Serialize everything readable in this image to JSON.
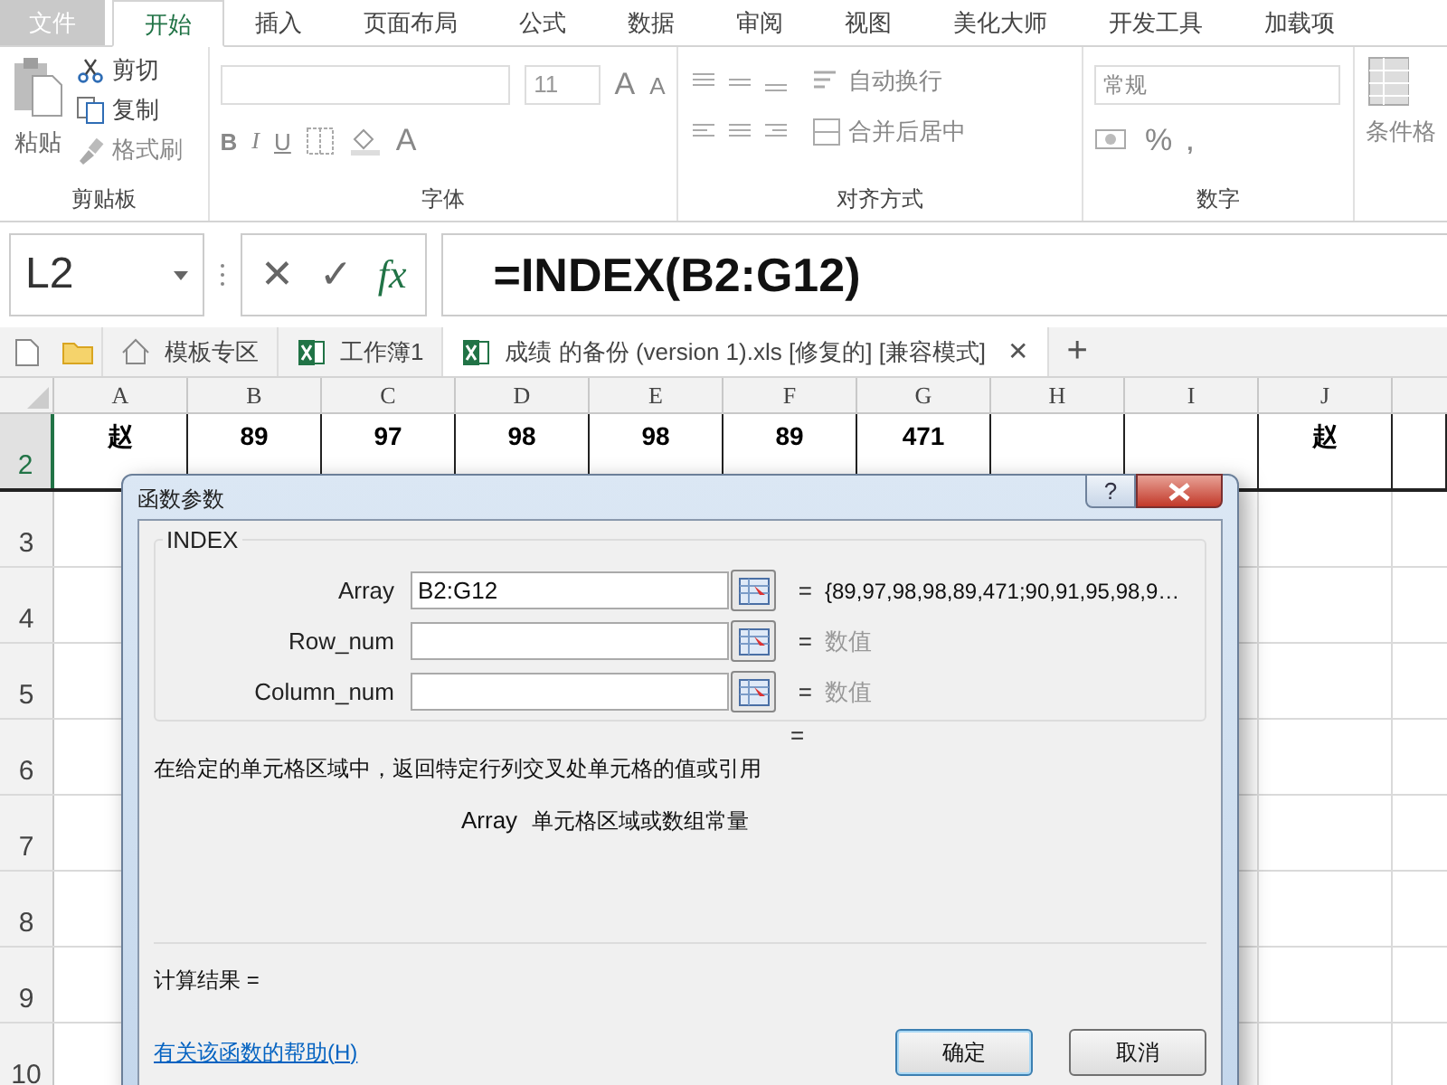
{
  "ribbon": {
    "tabs": [
      {
        "label": "文件",
        "kind": "file",
        "selected": false
      },
      {
        "label": "开始",
        "kind": "tab",
        "selected": true
      },
      {
        "label": "插入",
        "kind": "tab",
        "selected": false
      },
      {
        "label": "页面布局",
        "kind": "tab",
        "selected": false
      },
      {
        "label": "公式",
        "kind": "tab",
        "selected": false
      },
      {
        "label": "数据",
        "kind": "tab",
        "selected": false
      },
      {
        "label": "审阅",
        "kind": "tab",
        "selected": false
      },
      {
        "label": "视图",
        "kind": "tab",
        "selected": false
      },
      {
        "label": "美化大师",
        "kind": "tab",
        "selected": false
      },
      {
        "label": "开发工具",
        "kind": "tab",
        "selected": false
      },
      {
        "label": "加载项",
        "kind": "tab",
        "selected": false
      }
    ],
    "clipboard": {
      "paste": "粘贴",
      "cut": "剪切",
      "copy": "复制",
      "format_painter": "格式刷",
      "label": "剪贴板"
    },
    "font": {
      "size": "11",
      "grow": "A",
      "shrink": "A",
      "bold": "B",
      "italic": "I",
      "underline": "U",
      "font_color": "A",
      "label": "字体"
    },
    "alignment": {
      "wrap": "自动换行",
      "merge": "合并后居中",
      "label": "对齐方式"
    },
    "number": {
      "format": "常规",
      "percent": "%",
      "comma": ",",
      "label": "数字"
    },
    "styles": {
      "conditional": "条件格"
    }
  },
  "formula_bar": {
    "name_box": "L2",
    "cancel": "✕",
    "enter": "✓",
    "fx": "fx",
    "formula": "=INDEX(B2:G12)"
  },
  "doc_tabs": [
    {
      "label": "模板专区",
      "kind": "home",
      "selected": false
    },
    {
      "label": "工作簿1",
      "kind": "excel",
      "selected": false
    },
    {
      "label": "成绩 的备份 (version 1).xls [修复的]  [兼容模式]",
      "kind": "excel",
      "selected": true,
      "close": "✕"
    }
  ],
  "new_tab": "+",
  "sheet": {
    "columns": [
      "A",
      "B",
      "C",
      "D",
      "E",
      "F",
      "G",
      "H",
      "I",
      "J"
    ],
    "rows": [
      {
        "number": "2",
        "selected": true,
        "cells": {
          "A": "赵",
          "B": "89",
          "C": "97",
          "D": "98",
          "E": "98",
          "F": "89",
          "G": "471",
          "J": "赵"
        }
      },
      {
        "number": "3",
        "selected": false
      },
      {
        "number": "4",
        "selected": false
      },
      {
        "number": "5",
        "selected": false
      },
      {
        "number": "6",
        "selected": false
      },
      {
        "number": "7",
        "selected": false
      },
      {
        "number": "8",
        "selected": false
      },
      {
        "number": "9",
        "selected": false
      },
      {
        "number": "10",
        "selected": false
      }
    ]
  },
  "dialog": {
    "title": "函数参数",
    "help": "?",
    "function": "INDEX",
    "args": [
      {
        "label": "Array",
        "value": "B2:G12",
        "equals": "=",
        "result": "{89,97,98,98,89,471;90,91,95,98,9…",
        "hint": false
      },
      {
        "label": "Row_num",
        "equals": "=",
        "result": "数值",
        "hint": true
      },
      {
        "label": "Column_num",
        "equals": "=",
        "result": "数值",
        "hint": true
      }
    ],
    "formula_equals": "=",
    "description": "在给定的单元格区域中，返回特定行列交叉处单元格的值或引用",
    "arg_name": "Array",
    "arg_description": "单元格区域或数组常量",
    "result_label": "计算结果 =",
    "help_link": "有关该函数的帮助(H)",
    "ok": "确定",
    "cancel": "取消"
  }
}
